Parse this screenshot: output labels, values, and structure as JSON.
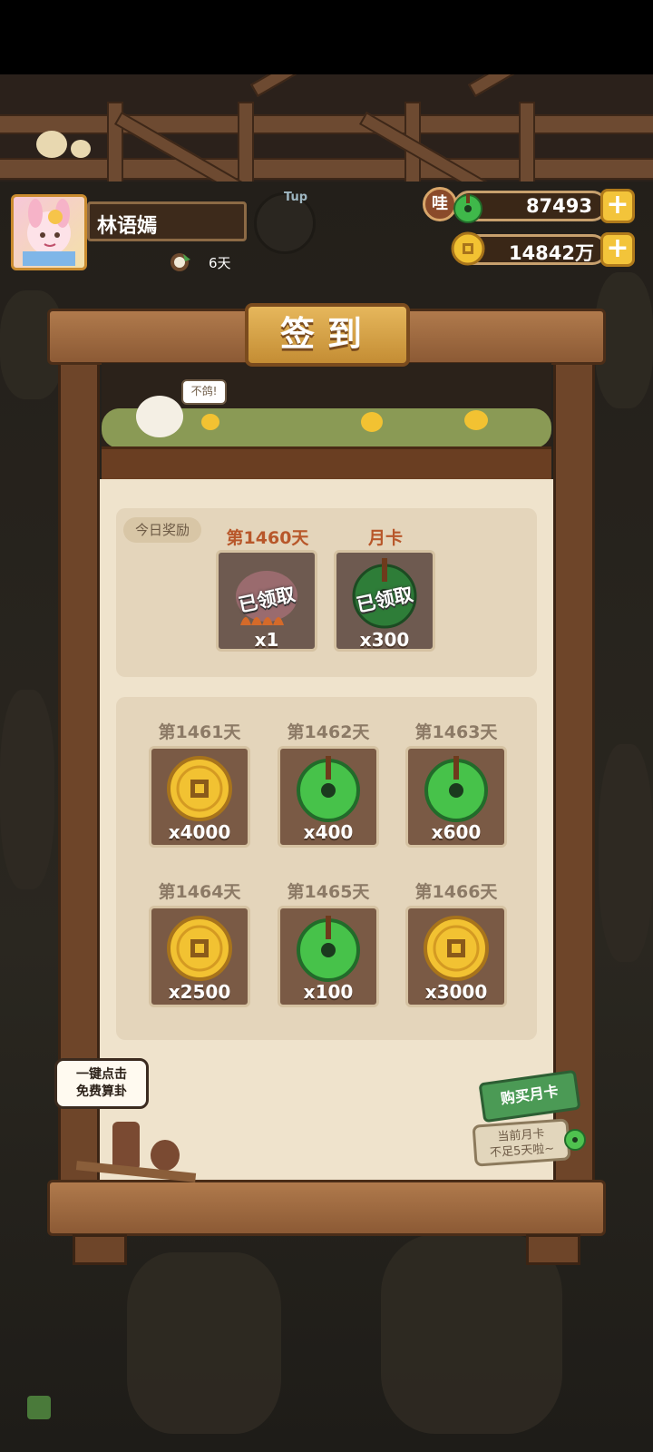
{
  "colors": {
    "accent_gold": "#f3c43a",
    "wood": "#6e4529",
    "day_label_today": "#b8572a",
    "day_label_future": "#8c7a66",
    "panel": "#efe3cc"
  },
  "player": {
    "name": "林语嫣",
    "streak": "6天"
  },
  "currencies": [
    {
      "icon": "green-jade-icon",
      "value": "87493",
      "badge": "哇"
    },
    {
      "icon": "gold-coin-icon",
      "value": "14842万"
    }
  ],
  "tup_label": "Tup",
  "title": "签到",
  "speech": "不鸽!",
  "today": {
    "tag": "今日奖励",
    "items": [
      {
        "label": "第1460天",
        "qty": "x1",
        "status": "已领取",
        "icon": "fire-gift-icon"
      },
      {
        "label": "月卡",
        "qty": "x300",
        "status": "已领取",
        "icon": "green-jade-icon"
      }
    ]
  },
  "days": [
    {
      "label": "第1461天",
      "qty": "x4000",
      "icon": "gold-coin-icon"
    },
    {
      "label": "第1462天",
      "qty": "x400",
      "icon": "green-jade-icon"
    },
    {
      "label": "第1463天",
      "qty": "x600",
      "icon": "green-jade-icon"
    },
    {
      "label": "第1464天",
      "qty": "x2500",
      "icon": "gold-coin-icon"
    },
    {
      "label": "第1465天",
      "qty": "x100",
      "icon": "green-jade-icon"
    },
    {
      "label": "第1466天",
      "qty": "x3000",
      "icon": "gold-coin-icon"
    }
  ],
  "onekey": {
    "line1": "一键点击",
    "line2": "免费算卦"
  },
  "buy_card": {
    "label": "购买月卡",
    "note_line1": "当前月卡",
    "note_line2": "不足5天啦~"
  }
}
